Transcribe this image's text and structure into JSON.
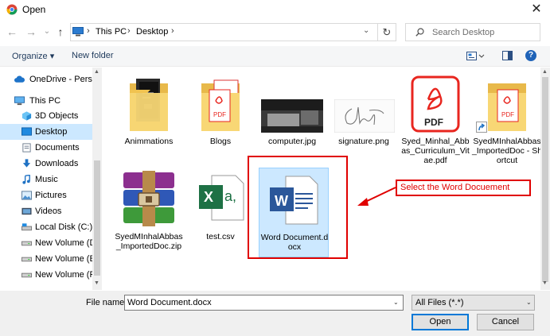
{
  "window": {
    "title": "Open",
    "app_icon": "chrome-icon",
    "close_icon": "close-icon",
    "close_glyph": "✕"
  },
  "nav": {
    "back_glyph": "←",
    "forward_glyph": "→",
    "recent_glyph": "⌄",
    "up_glyph": "↑",
    "breadcrumb": [
      "This PC",
      "Desktop"
    ],
    "separator": "›",
    "dropdown_glyph": "⌄",
    "refresh_glyph": "↻",
    "search_placeholder": "Search Desktop"
  },
  "toolbar": {
    "organize_label": "Organize ▾",
    "new_folder_label": "New folder",
    "help_glyph": "?"
  },
  "sidebar": {
    "items": [
      {
        "label": "OneDrive - Persor",
        "icon": "cloud-icon"
      },
      {
        "label": "This PC",
        "icon": "computer-icon"
      },
      {
        "label": "3D Objects",
        "icon": "cube-icon"
      },
      {
        "label": "Desktop",
        "icon": "desktop-icon"
      },
      {
        "label": "Documents",
        "icon": "documents-icon"
      },
      {
        "label": "Downloads",
        "icon": "download-icon"
      },
      {
        "label": "Music",
        "icon": "music-icon"
      },
      {
        "label": "Pictures",
        "icon": "pictures-icon"
      },
      {
        "label": "Videos",
        "icon": "videos-icon"
      },
      {
        "label": "Local Disk (C:)",
        "icon": "disk-icon"
      },
      {
        "label": "New Volume (D:",
        "icon": "drive-icon"
      },
      {
        "label": "New Volume (E:)",
        "icon": "drive-icon"
      },
      {
        "label": "New Volume (F:)",
        "icon": "drive-icon"
      }
    ],
    "selected": "Desktop",
    "chevron_glyph": "›",
    "scroll_up": "▲",
    "scroll_down": "▼"
  },
  "files": [
    {
      "name": "Animmations",
      "type": "folder"
    },
    {
      "name": "Blogs",
      "type": "folder-pdf"
    },
    {
      "name": "computer.jpg",
      "type": "image"
    },
    {
      "name": "signature.png",
      "type": "image"
    },
    {
      "name": "Syed_Minhal_Abbas_Curriculum_Vitae.pdf",
      "type": "pdf",
      "icon_text": "PDF"
    },
    {
      "name": "SyedMInhalAbbas_ImportedDoc - Shortcut",
      "type": "shortcut"
    },
    {
      "name": "SyedMInhalAbbas_ImportedDoc.zip",
      "type": "zip"
    },
    {
      "name": "test.csv",
      "type": "csv",
      "icon_text": "X",
      "icon_sub": "a,"
    },
    {
      "name": "Word Document.docx",
      "type": "docx",
      "icon_text": "W"
    }
  ],
  "annotation": {
    "text": "Select the Word Docuement",
    "color": "#e00000"
  },
  "bottom": {
    "file_name_label": "File name:",
    "file_name_value": "Word Document.docx",
    "file_type_value": "All Files (*.*)",
    "dropdown_glyph": "⌄",
    "open_label": "Open",
    "cancel_label": "Cancel"
  },
  "colors": {
    "selection": "#cce8ff",
    "accent": "#0078d7",
    "folder": "#f8d775",
    "pdf_red": "#e8261f",
    "excel_green": "#1e7145",
    "word_blue": "#2b579a"
  }
}
